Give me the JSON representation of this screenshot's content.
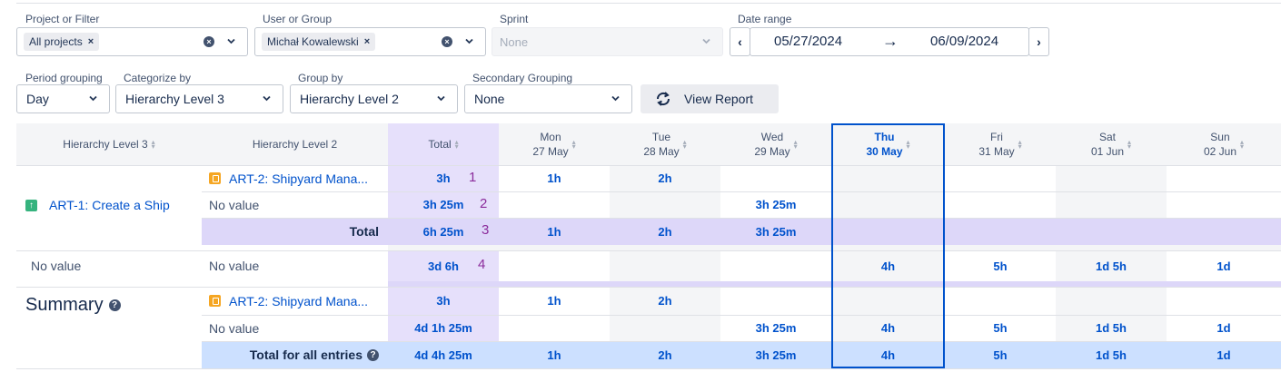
{
  "filters": {
    "project": {
      "label": "Project or Filter",
      "chip": "All projects",
      "remove": "×"
    },
    "user": {
      "label": "User or Group",
      "chip": "Michał Kowalewski",
      "remove": "×"
    },
    "sprint": {
      "label": "Sprint",
      "placeholder": "None"
    },
    "date_range": {
      "label": "Date range",
      "from": "05/27/2024",
      "to": "06/09/2024",
      "arrow": "→",
      "prev": "‹",
      "next": "›"
    },
    "period": {
      "label": "Period grouping",
      "value": "Day"
    },
    "categorize": {
      "label": "Categorize by",
      "value": "Hierarchy Level 3"
    },
    "group": {
      "label": "Group by",
      "value": "Hierarchy Level 2"
    },
    "secondary": {
      "label": "Secondary Grouping",
      "value": "None"
    },
    "view_report": {
      "label": "View Report",
      "icon": "refresh-icon"
    }
  },
  "table": {
    "headers": {
      "level3": "Hierarchy Level 3",
      "level2": "Hierarchy Level 2",
      "total": "Total",
      "days": [
        {
          "day": "Mon",
          "date": "27 May"
        },
        {
          "day": "Tue",
          "date": "28 May"
        },
        {
          "day": "Wed",
          "date": "29 May"
        },
        {
          "day": "Thu",
          "date": "30 May"
        },
        {
          "day": "Fri",
          "date": "31 May"
        },
        {
          "day": "Sat",
          "date": "01 Jun"
        },
        {
          "day": "Sun",
          "date": "02 Jun"
        }
      ]
    },
    "group1": {
      "name": "ART-1: Create a Ship",
      "rows": [
        {
          "label": "ART-2: Shipyard Mana...",
          "total": "3h",
          "annot": "1",
          "cells": [
            "1h",
            "2h",
            "",
            "",
            "",
            "",
            ""
          ]
        },
        {
          "label": "No value",
          "total": "3h 25m",
          "annot": "2",
          "cells": [
            "",
            "",
            "3h 25m",
            "",
            "",
            "",
            ""
          ]
        }
      ],
      "total_row": {
        "label": "Total",
        "total": "6h 25m",
        "annot": "3",
        "cells": [
          "1h",
          "2h",
          "3h 25m",
          "",
          "",
          "",
          ""
        ]
      }
    },
    "group2": {
      "name": "No value",
      "rows": [
        {
          "label": "No value",
          "total": "3d 6h",
          "annot": "4",
          "cells": [
            "",
            "",
            "",
            "4h",
            "5h",
            "1d 5h",
            "1d"
          ]
        }
      ]
    },
    "summary": {
      "title": "Summary",
      "help_icon": "?",
      "rows": [
        {
          "label": "ART-2: Shipyard Mana...",
          "total": "3h",
          "cells": [
            "1h",
            "2h",
            "",
            "",
            "",
            "",
            ""
          ]
        },
        {
          "label": "No value",
          "total": "4d 1h 25m",
          "cells": [
            "",
            "",
            "3h 25m",
            "4h",
            "5h",
            "1d 5h",
            "1d"
          ]
        }
      ],
      "total_row": {
        "label": "Total for all entries",
        "help_icon": "?",
        "total": "4d 4h 25m",
        "cells": [
          "1h",
          "2h",
          "3h 25m",
          "4h",
          "5h",
          "1d 5h",
          "1d"
        ]
      }
    }
  },
  "colors": {
    "accent": "#0052cc",
    "total_column": "#e6e0fb",
    "total_row": "#ddd7f9",
    "grand_total_row": "#cce0ff",
    "highlight_border": "#0052cc",
    "weekend_gray": "#f4f5f7"
  }
}
